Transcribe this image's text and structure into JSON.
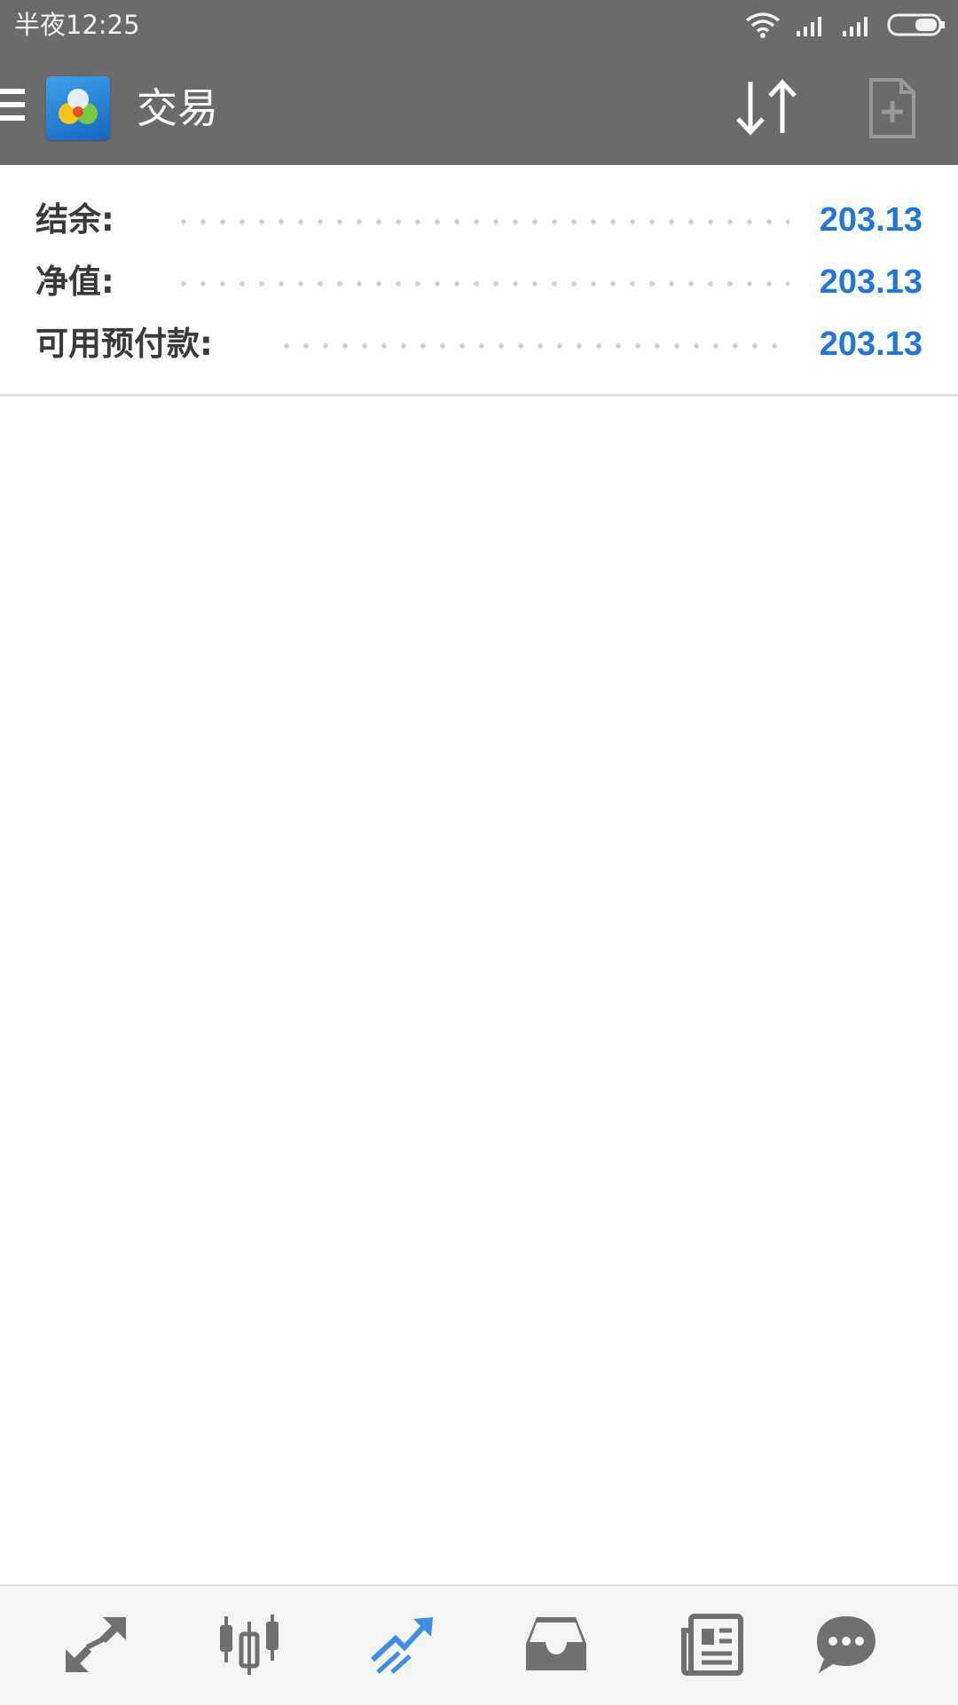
{
  "status_bar": {
    "time": "半夜12:25",
    "icons": [
      "wifi-icon",
      "signal-icon",
      "signal-icon",
      "battery-icon"
    ]
  },
  "toolbar": {
    "title": "交易",
    "icons": [
      "menu-icon",
      "app-logo",
      "sort-icon",
      "new-order-icon"
    ]
  },
  "account": {
    "rows": [
      {
        "label": "结余:",
        "value": "203.13"
      },
      {
        "label": "净值:",
        "value": "203.13"
      },
      {
        "label": "可用预付款:",
        "value": "203.13"
      }
    ]
  },
  "bottom_nav": {
    "items": [
      {
        "name": "quotes",
        "icon": "quotes-arrows-icon",
        "active": false
      },
      {
        "name": "chart",
        "icon": "candlestick-icon",
        "active": false
      },
      {
        "name": "trade",
        "icon": "trade-trend-icon",
        "active": true
      },
      {
        "name": "history",
        "icon": "inbox-icon",
        "active": false
      },
      {
        "name": "news",
        "icon": "newspaper-icon",
        "active": false
      },
      {
        "name": "chat",
        "icon": "chat-bubble-icon",
        "active": false
      }
    ]
  },
  "colors": {
    "bar_background": "#6a6b6a",
    "value_blue": "#1f78d8",
    "active_nav": "#3d8fe6",
    "inactive_nav": "#707070"
  }
}
